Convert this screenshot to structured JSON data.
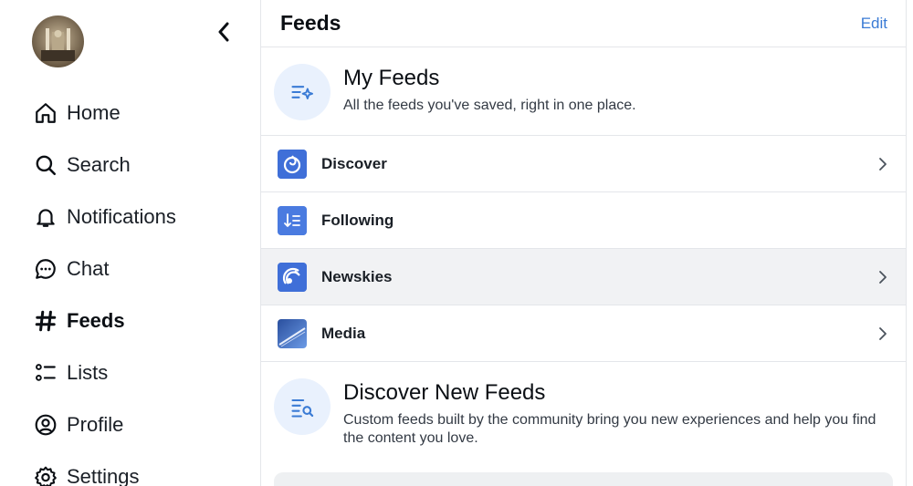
{
  "sidebar": {
    "nav": [
      {
        "label": "Home",
        "icon": "home-icon"
      },
      {
        "label": "Search",
        "icon": "search-icon"
      },
      {
        "label": "Notifications",
        "icon": "bell-icon"
      },
      {
        "label": "Chat",
        "icon": "chat-icon"
      },
      {
        "label": "Feeds",
        "icon": "hash-icon",
        "active": true
      },
      {
        "label": "Lists",
        "icon": "list-icon"
      },
      {
        "label": "Profile",
        "icon": "user-circle-icon"
      },
      {
        "label": "Settings",
        "icon": "gear-icon"
      }
    ]
  },
  "header": {
    "title": "Feeds",
    "edit_label": "Edit"
  },
  "my_feeds": {
    "title": "My Feeds",
    "subtitle": "All the feeds you've saved, right in one place."
  },
  "feeds": [
    {
      "name": "Discover",
      "has_chevron": true
    },
    {
      "name": "Following",
      "has_chevron": false
    },
    {
      "name": "Newskies",
      "has_chevron": true,
      "highlighted": true
    },
    {
      "name": "Media",
      "has_chevron": true
    }
  ],
  "discover_new": {
    "title": "Discover New Feeds",
    "subtitle": "Custom feeds built by the community bring you new experiences and help you find the content you love."
  },
  "colors": {
    "accent": "#3a7bd5",
    "icon_bg": "#e9f1fd",
    "hover_row": "#f1f2f4",
    "border": "#e4e6ea"
  }
}
